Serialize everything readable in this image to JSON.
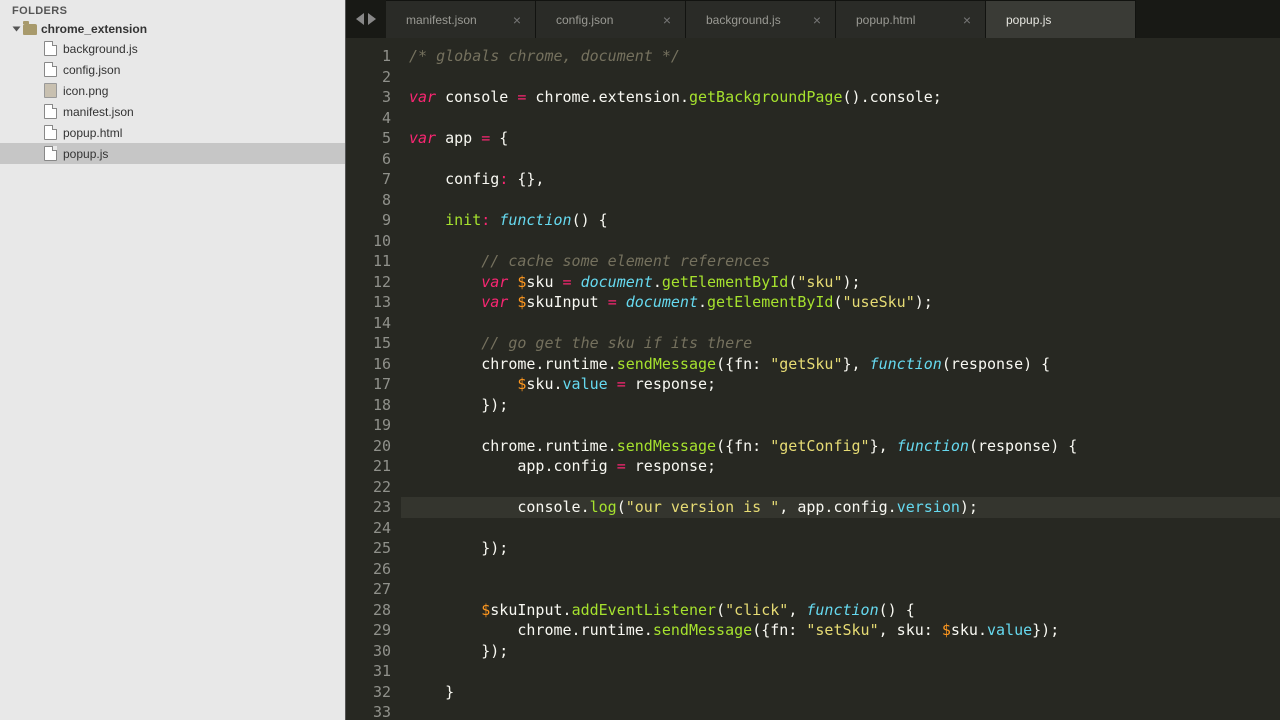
{
  "sidebar": {
    "header": "FOLDERS",
    "folder": "chrome_extension",
    "files": [
      {
        "name": "background.js",
        "icon": "file"
      },
      {
        "name": "config.json",
        "icon": "file"
      },
      {
        "name": "icon.png",
        "icon": "img"
      },
      {
        "name": "manifest.json",
        "icon": "file"
      },
      {
        "name": "popup.html",
        "icon": "file"
      },
      {
        "name": "popup.js",
        "icon": "file",
        "selected": true
      }
    ]
  },
  "tabs": [
    {
      "label": "manifest.json"
    },
    {
      "label": "config.json"
    },
    {
      "label": "background.js"
    },
    {
      "label": "popup.html"
    },
    {
      "label": "popup.js",
      "active": true
    }
  ],
  "activeLine": 23,
  "code": [
    {
      "n": 1,
      "t": [
        [
          "c",
          "/* globals chrome, document */"
        ]
      ]
    },
    {
      "n": 2,
      "t": [
        [
          "w",
          ""
        ]
      ]
    },
    {
      "n": 3,
      "t": [
        [
          "k",
          "var"
        ],
        [
          "w",
          " console "
        ],
        [
          "o",
          "="
        ],
        [
          "w",
          " chrome"
        ],
        [
          "w",
          "."
        ],
        [
          "w",
          "extension"
        ],
        [
          "w",
          "."
        ],
        [
          "n",
          "getBackgroundPage"
        ],
        [
          "w",
          "()"
        ],
        [
          "w",
          "."
        ],
        [
          "w",
          "console;"
        ]
      ]
    },
    {
      "n": 4,
      "t": [
        [
          "w",
          ""
        ]
      ]
    },
    {
      "n": 5,
      "t": [
        [
          "k",
          "var"
        ],
        [
          "w",
          " app "
        ],
        [
          "o",
          "="
        ],
        [
          "w",
          " {"
        ]
      ]
    },
    {
      "n": 6,
      "t": [
        [
          "w",
          ""
        ]
      ]
    },
    {
      "n": 7,
      "t": [
        [
          "w",
          "    config"
        ],
        [
          "o",
          ":"
        ],
        [
          "w",
          " {},"
        ]
      ]
    },
    {
      "n": 8,
      "t": [
        [
          "w",
          ""
        ]
      ]
    },
    {
      "n": 9,
      "t": [
        [
          "w",
          "    "
        ],
        [
          "n",
          "init"
        ],
        [
          "o",
          ":"
        ],
        [
          "w",
          " "
        ],
        [
          "kf",
          "function"
        ],
        [
          "w",
          "() {"
        ]
      ]
    },
    {
      "n": 10,
      "t": [
        [
          "w",
          ""
        ]
      ]
    },
    {
      "n": 11,
      "t": [
        [
          "w",
          "        "
        ],
        [
          "c",
          "// cache some element references"
        ]
      ]
    },
    {
      "n": 12,
      "t": [
        [
          "w",
          "        "
        ],
        [
          "k",
          "var"
        ],
        [
          "w",
          " "
        ],
        [
          "v",
          "$"
        ],
        [
          "w",
          "sku "
        ],
        [
          "o",
          "="
        ],
        [
          "w",
          " "
        ],
        [
          "kf",
          "document"
        ],
        [
          "w",
          "."
        ],
        [
          "n",
          "getElementById"
        ],
        [
          "w",
          "("
        ],
        [
          "s",
          "\"sku\""
        ],
        [
          "w",
          ");"
        ]
      ]
    },
    {
      "n": 13,
      "t": [
        [
          "w",
          "        "
        ],
        [
          "k",
          "var"
        ],
        [
          "w",
          " "
        ],
        [
          "v",
          "$"
        ],
        [
          "w",
          "skuInput "
        ],
        [
          "o",
          "="
        ],
        [
          "w",
          " "
        ],
        [
          "kf",
          "document"
        ],
        [
          "w",
          "."
        ],
        [
          "n",
          "getElementById"
        ],
        [
          "w",
          "("
        ],
        [
          "s",
          "\"useSku\""
        ],
        [
          "w",
          ");"
        ]
      ]
    },
    {
      "n": 14,
      "t": [
        [
          "w",
          ""
        ]
      ]
    },
    {
      "n": 15,
      "t": [
        [
          "w",
          "        "
        ],
        [
          "c",
          "// go get the sku if its there"
        ]
      ]
    },
    {
      "n": 16,
      "t": [
        [
          "w",
          "        chrome.runtime."
        ],
        [
          "n",
          "sendMessage"
        ],
        [
          "w",
          "({fn: "
        ],
        [
          "s",
          "\"getSku\""
        ],
        [
          "w",
          "}, "
        ],
        [
          "kf",
          "function"
        ],
        [
          "w",
          "(response) {"
        ]
      ]
    },
    {
      "n": 17,
      "t": [
        [
          "w",
          "            "
        ],
        [
          "v",
          "$"
        ],
        [
          "w",
          "sku."
        ],
        [
          "propblue",
          "value"
        ],
        [
          "w",
          " "
        ],
        [
          "o",
          "="
        ],
        [
          "w",
          " response;"
        ]
      ]
    },
    {
      "n": 18,
      "t": [
        [
          "w",
          "        });"
        ]
      ]
    },
    {
      "n": 19,
      "t": [
        [
          "w",
          ""
        ]
      ]
    },
    {
      "n": 20,
      "t": [
        [
          "w",
          "        chrome.runtime."
        ],
        [
          "n",
          "sendMessage"
        ],
        [
          "w",
          "({fn: "
        ],
        [
          "s",
          "\"getConfig\""
        ],
        [
          "w",
          "}, "
        ],
        [
          "kf",
          "function"
        ],
        [
          "w",
          "(response) {"
        ]
      ]
    },
    {
      "n": 21,
      "t": [
        [
          "w",
          "            app.config "
        ],
        [
          "o",
          "="
        ],
        [
          "w",
          " response;"
        ]
      ]
    },
    {
      "n": 22,
      "t": [
        [
          "w",
          ""
        ]
      ]
    },
    {
      "n": 23,
      "t": [
        [
          "w",
          "            console."
        ],
        [
          "n",
          "log"
        ],
        [
          "w",
          "("
        ],
        [
          "s",
          "\"our version is \""
        ],
        [
          "w",
          ", app.config."
        ],
        [
          "propblue",
          "version"
        ],
        [
          "w",
          ");"
        ]
      ]
    },
    {
      "n": 24,
      "t": [
        [
          "w",
          ""
        ]
      ]
    },
    {
      "n": 25,
      "t": [
        [
          "w",
          "        });"
        ]
      ]
    },
    {
      "n": 26,
      "t": [
        [
          "w",
          ""
        ]
      ]
    },
    {
      "n": 27,
      "t": [
        [
          "w",
          ""
        ]
      ]
    },
    {
      "n": 28,
      "t": [
        [
          "w",
          "        "
        ],
        [
          "v",
          "$"
        ],
        [
          "w",
          "skuInput."
        ],
        [
          "n",
          "addEventListener"
        ],
        [
          "w",
          "("
        ],
        [
          "s",
          "\"click\""
        ],
        [
          "w",
          ", "
        ],
        [
          "kf",
          "function"
        ],
        [
          "w",
          "() {"
        ]
      ]
    },
    {
      "n": 29,
      "t": [
        [
          "w",
          "            chrome.runtime."
        ],
        [
          "n",
          "sendMessage"
        ],
        [
          "w",
          "({fn: "
        ],
        [
          "s",
          "\"setSku\""
        ],
        [
          "w",
          ", sku: "
        ],
        [
          "v",
          "$"
        ],
        [
          "w",
          "sku."
        ],
        [
          "propblue",
          "value"
        ],
        [
          "w",
          "});"
        ]
      ]
    },
    {
      "n": 30,
      "t": [
        [
          "w",
          "        });"
        ]
      ]
    },
    {
      "n": 31,
      "t": [
        [
          "w",
          ""
        ]
      ]
    },
    {
      "n": 32,
      "t": [
        [
          "w",
          "    }"
        ]
      ]
    },
    {
      "n": 33,
      "t": [
        [
          "w",
          ""
        ]
      ]
    }
  ]
}
